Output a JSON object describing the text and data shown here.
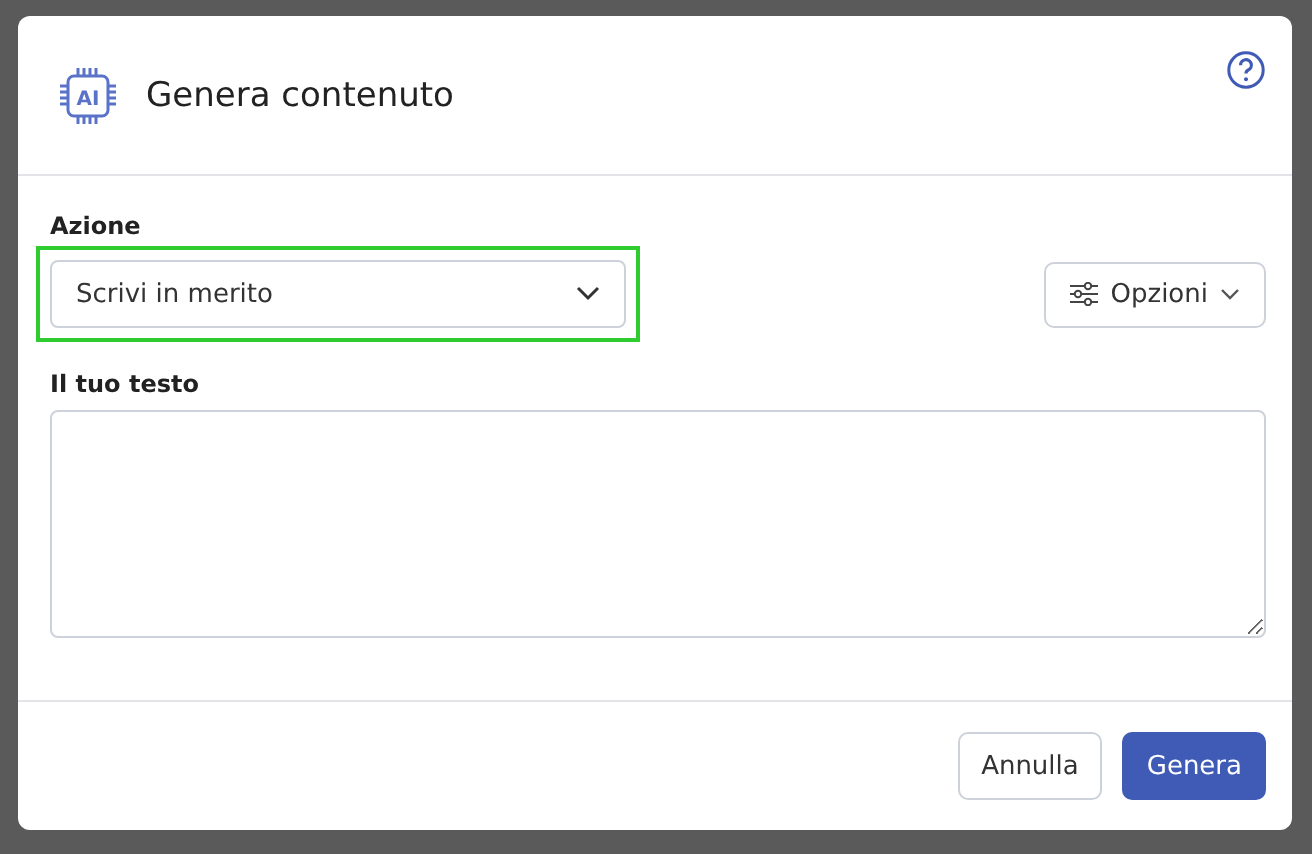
{
  "dialog": {
    "title": "Genera contenuto",
    "logo_text": "AI"
  },
  "action": {
    "label": "Azione",
    "value": "Scrivi in merito",
    "highlighted": true
  },
  "options_button": {
    "label": "Opzioni"
  },
  "text_field": {
    "label": "Il tuo testo"
  },
  "buttons": [
    {
      "label": "Annulla",
      "kind": "secondary"
    },
    {
      "label": "Genera",
      "kind": "primary"
    }
  ]
}
